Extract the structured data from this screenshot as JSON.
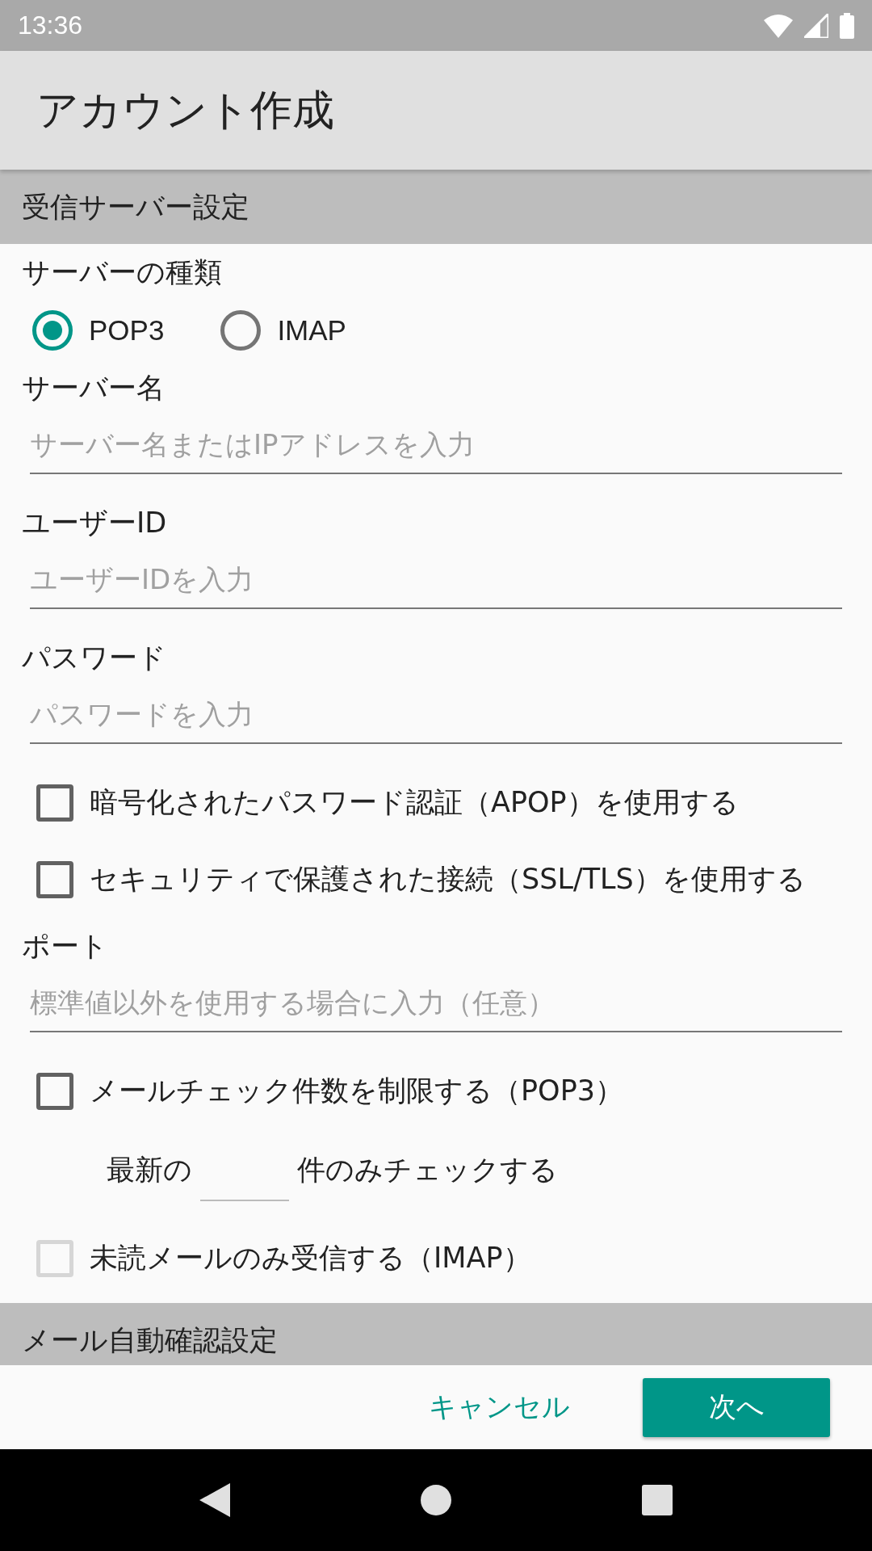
{
  "status_bar": {
    "time": "13:36"
  },
  "app_bar": {
    "title": "アカウント作成"
  },
  "sections": [
    {
      "title": "受信サーバー設定",
      "items": [
        {
          "kind": "label",
          "text": "サーバーの種類"
        },
        {
          "kind": "radio_group",
          "options": [
            {
              "label": "POP3",
              "selected": true
            },
            {
              "label": "IMAP",
              "selected": false
            }
          ]
        },
        {
          "kind": "label",
          "text": "サーバー名"
        },
        {
          "kind": "field",
          "placeholder": "サーバー名またはIPアドレスを入力"
        },
        {
          "kind": "label",
          "text": "ユーザーID"
        },
        {
          "kind": "field",
          "placeholder": "ユーザーIDを入力"
        },
        {
          "kind": "label",
          "text": "パスワード"
        },
        {
          "kind": "field",
          "placeholder": "パスワードを入力"
        },
        {
          "kind": "checkbox",
          "label": "暗号化されたパスワード認証（APOP）を使用する",
          "checked": false,
          "disabled": false
        },
        {
          "kind": "checkbox",
          "label": "セキュリティで保護された接続（SSL/TLS）を使用する",
          "checked": false,
          "disabled": false
        },
        {
          "kind": "label",
          "text": "ポート"
        },
        {
          "kind": "field",
          "placeholder": "標準値以外を使用する場合に入力（任意）"
        },
        {
          "kind": "checkbox",
          "label": "メールチェック件数を制限する（POP3）",
          "checked": false,
          "disabled": false
        },
        {
          "kind": "count_row",
          "before": "最新の",
          "after": "件のみチェックする"
        },
        {
          "kind": "checkbox",
          "label": "未読メールのみ受信する（IMAP）",
          "checked": false,
          "disabled": true
        }
      ]
    },
    {
      "title": "メール自動確認設定"
    }
  ],
  "footer": {
    "cancel": "キャンセル",
    "next": "次へ"
  }
}
